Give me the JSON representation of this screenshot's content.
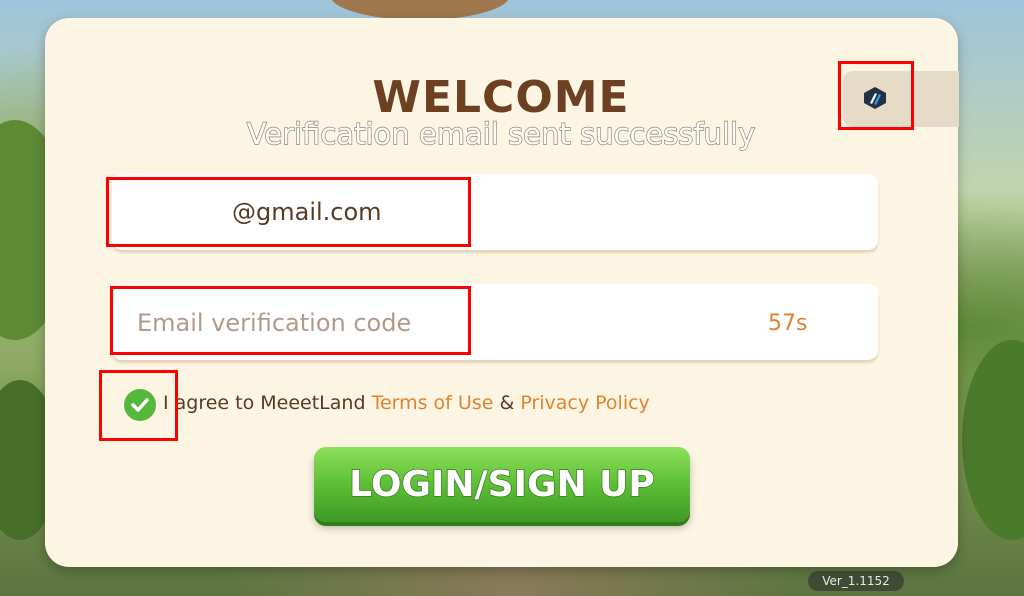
{
  "colors": {
    "panel": "#fdf5e3",
    "title": "#6e4022",
    "link": "#e0832c",
    "button": "#5cbf35",
    "highlight": "#ff0000"
  },
  "header": {
    "title": "WELCOME",
    "subtitle": "Verification email sent successfully",
    "language_icon": "arbitrum-logo-icon"
  },
  "form": {
    "email_value": "@gmail.com",
    "code_placeholder": "Email verification code",
    "countdown": "57s",
    "agree_checked": true,
    "agree_text": "I agree to MeeetLand ",
    "terms_link": "Terms of Use",
    "ampersand": " & ",
    "privacy_link": "Privacy Policy",
    "submit_label": "LOGIN/SIGN UP"
  },
  "footer": {
    "version": "Ver_1.1152"
  }
}
